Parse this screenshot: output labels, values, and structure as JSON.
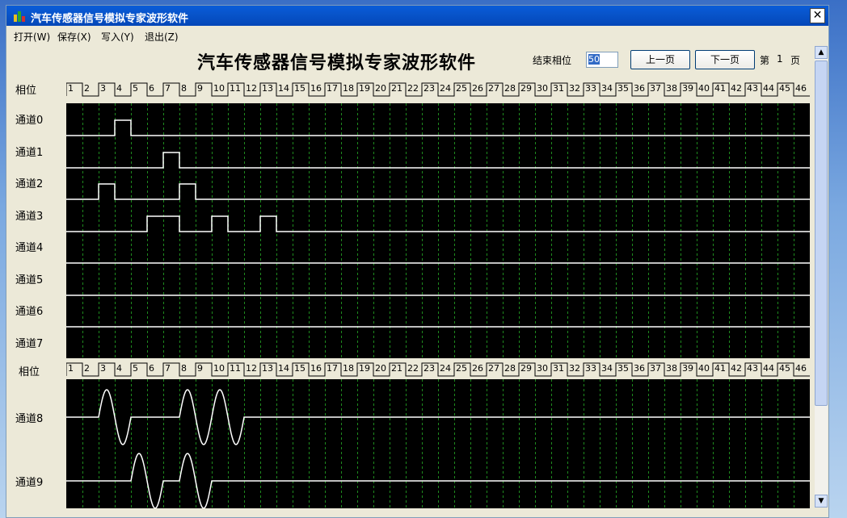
{
  "window": {
    "title": "汽车传感器信号模拟专家波形软件",
    "close_symbol": "✕"
  },
  "menu": [
    "打开(W)",
    "保存(X)",
    "写入(Y)",
    "退出(Z)"
  ],
  "header": {
    "headline": "汽车传感器信号模拟专家波形软件",
    "end_phase_label": "结束相位",
    "end_phase_value": "50",
    "prev_button": "上一页",
    "next_button": "下一页",
    "page_prefix": "第",
    "page_number": "1",
    "page_suffix": "页"
  },
  "phase_label": "相位",
  "phase_ticks": [
    "1",
    "2",
    "3",
    "4",
    "5",
    "6",
    "7",
    "8",
    "9",
    "10",
    "11",
    "12",
    "13",
    "14",
    "15",
    "16",
    "17",
    "18",
    "19",
    "20",
    "21",
    "22",
    "23",
    "24",
    "25",
    "26",
    "27",
    "28",
    "29",
    "30",
    "31",
    "32",
    "33",
    "34",
    "35",
    "36",
    "37",
    "38",
    "39",
    "40",
    "41",
    "42",
    "43",
    "44",
    "45",
    "46"
  ],
  "digital_channels": [
    {
      "label": "通道0",
      "high_phases": [
        4
      ]
    },
    {
      "label": "通道1",
      "high_phases": [
        7
      ]
    },
    {
      "label": "通道2",
      "high_phases": [
        3,
        8
      ]
    },
    {
      "label": "通道3",
      "high_phases": [
        6,
        7,
        10,
        13
      ]
    },
    {
      "label": "通道4",
      "high_phases": []
    },
    {
      "label": "通道5",
      "high_phases": []
    },
    {
      "label": "通道6",
      "high_phases": []
    },
    {
      "label": "通道7",
      "high_phases": []
    }
  ],
  "analog_channels": [
    {
      "label": "通道8",
      "sine_cycles_start_phase": [
        3,
        8,
        10
      ]
    },
    {
      "label": "通道9",
      "sine_cycles_start_phase": [
        5,
        8
      ]
    }
  ],
  "colors": {
    "plot_bg": "#000000",
    "trace": "#ffffff",
    "grid": "#1e8a1e"
  }
}
